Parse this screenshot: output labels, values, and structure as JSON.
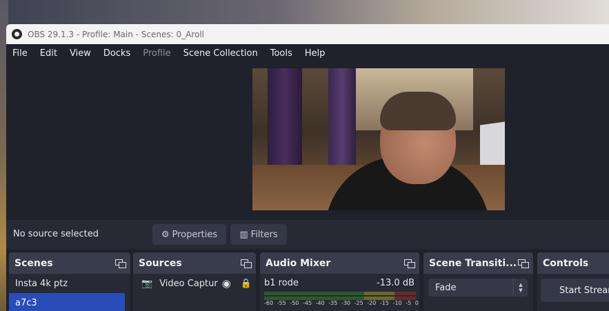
{
  "window": {
    "title": "OBS 29.1.3 - Profile: Main - Scenes: 0_Aroll"
  },
  "menu": {
    "items": [
      {
        "label": "File",
        "disabled": false
      },
      {
        "label": "Edit",
        "disabled": false
      },
      {
        "label": "View",
        "disabled": false
      },
      {
        "label": "Docks",
        "disabled": false
      },
      {
        "label": "Profile",
        "disabled": true
      },
      {
        "label": "Scene Collection",
        "disabled": false
      },
      {
        "label": "Tools",
        "disabled": false
      },
      {
        "label": "Help",
        "disabled": false
      }
    ]
  },
  "properties_bar": {
    "status": "No source selected",
    "properties_label": "Properties",
    "filters_label": "Filters"
  },
  "scenes": {
    "title": "Scenes",
    "items": [
      "Insta 4k ptz",
      "a7c3"
    ]
  },
  "sources": {
    "title": "Sources",
    "items": [
      {
        "label": "Video Captur"
      }
    ]
  },
  "audio_mixer": {
    "title": "Audio Mixer",
    "channel": "b1 rode",
    "level": "-13.0 dB",
    "ticks": [
      "-60",
      "-55",
      "-50",
      "-45",
      "-40",
      "-35",
      "-30",
      "-25",
      "-20",
      "-15",
      "-10",
      "-5",
      "0"
    ]
  },
  "transitions": {
    "title": "Scene Transiti...",
    "selected": "Fade"
  },
  "controls": {
    "title": "Controls",
    "start_stream": "Start Stream"
  },
  "colors": {
    "accent_selected": "#284cb8",
    "panel_bg": "#272935",
    "dock_header": "#393c4a"
  }
}
